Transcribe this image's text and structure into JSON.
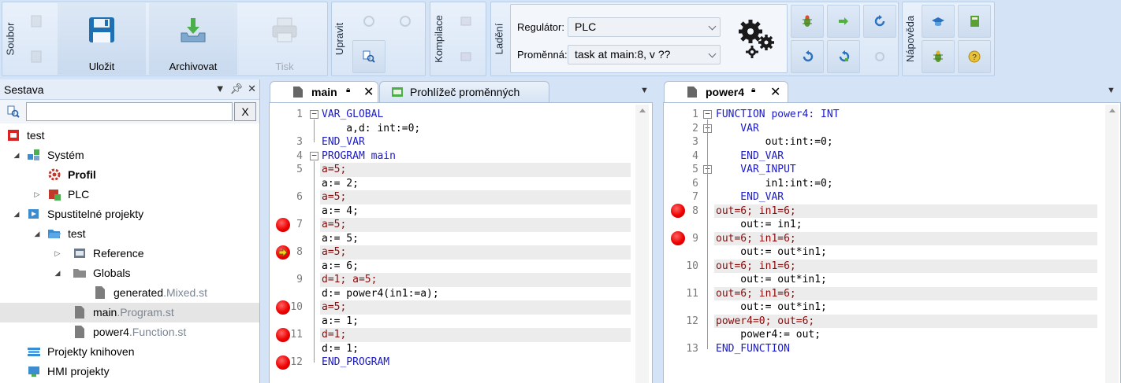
{
  "ribbon": {
    "groups": {
      "soubor": "Soubor",
      "upravit": "Upravit",
      "kompilace": "Kompilace",
      "ladeni": "Ladění",
      "napoveda": "Nápověda"
    },
    "save_label": "Uložit",
    "archive_label": "Archivovat",
    "print_label": "Tisk",
    "regulator_label": "Regulátor:",
    "regulator_value": "PLC",
    "variable_label": "Proměnná:",
    "variable_value": "task at main:8, v ??"
  },
  "left_panel": {
    "title": "Sestava",
    "clear_button": "X",
    "search_value": "",
    "tree": [
      {
        "label": "test",
        "ext": "",
        "icon": "project-red-icon"
      },
      {
        "label": "Systém",
        "ext": "",
        "icon": "system-icon"
      },
      {
        "label": "Profil",
        "ext": "",
        "icon": "gear-red-icon"
      },
      {
        "label": "PLC",
        "ext": "",
        "icon": "plc-icon"
      },
      {
        "label": "Spustitelné projekty",
        "ext": "",
        "icon": "executable-projects-icon"
      },
      {
        "label": "test",
        "ext": "",
        "icon": "folder-open-icon"
      },
      {
        "label": "Reference",
        "ext": "",
        "icon": "reference-icon"
      },
      {
        "label": "Globals",
        "ext": "",
        "icon": "folder-icon"
      },
      {
        "label": "generated",
        "ext": ".Mixed.st",
        "icon": "file-icon"
      },
      {
        "label": "main",
        "ext": ".Program.st",
        "icon": "file-icon"
      },
      {
        "label": "power4",
        "ext": ".Function.st",
        "icon": "file-icon"
      },
      {
        "label": "Projekty knihoven",
        "ext": "",
        "icon": "library-icon"
      },
      {
        "label": "HMI projekty",
        "ext": "",
        "icon": "hmi-icon"
      }
    ]
  },
  "editor_left": {
    "tabs": [
      {
        "label": "main"
      },
      {
        "label": "Prohlížeč proměnných"
      }
    ],
    "lines": [
      {
        "num": "1",
        "code": "VAR_GLOBAL",
        "kind": "kw"
      },
      {
        "num": "",
        "code": "    a,d: int:=0;",
        "kind": "decl"
      },
      {
        "num": "3",
        "code": "END_VAR",
        "kind": "kw"
      },
      {
        "num": "4",
        "code": "PROGRAM main",
        "kind": "prog"
      },
      {
        "num": "5",
        "code": "a=5;",
        "kind": "cur"
      },
      {
        "num": "",
        "code": "a:= 2;",
        "kind": "plain"
      },
      {
        "num": "6",
        "code": "a=5;",
        "kind": "cur"
      },
      {
        "num": "",
        "code": "a:= 4;",
        "kind": "plain"
      },
      {
        "num": "7",
        "code": "a=5;",
        "kind": "cur"
      },
      {
        "num": "",
        "code": "a:= 5;",
        "kind": "plain"
      },
      {
        "num": "8",
        "code": "a=5;",
        "kind": "cur"
      },
      {
        "num": "",
        "code": "a:= 6;",
        "kind": "plain"
      },
      {
        "num": "9",
        "code": "d=1; a=5;",
        "kind": "cur"
      },
      {
        "num": "",
        "code": "d:= power4(in1:=a);",
        "kind": "plain"
      },
      {
        "num": "10",
        "code": "a=5;",
        "kind": "cur"
      },
      {
        "num": "",
        "code": "a:= 1;",
        "kind": "plain"
      },
      {
        "num": "11",
        "code": "d=1;",
        "kind": "cur"
      },
      {
        "num": "",
        "code": "d:= 1;",
        "kind": "plain"
      },
      {
        "num": "12",
        "code": "END_PROGRAM",
        "kind": "kw"
      }
    ]
  },
  "editor_right": {
    "tabs": [
      {
        "label": "power4"
      }
    ],
    "lines": [
      {
        "num": "1",
        "code": "FUNCTION power4: INT",
        "kind": "func"
      },
      {
        "num": "2",
        "code": "    VAR",
        "kind": "kw"
      },
      {
        "num": "3",
        "code": "        out:int:=0;",
        "kind": "decl"
      },
      {
        "num": "4",
        "code": "    END_VAR",
        "kind": "kw"
      },
      {
        "num": "5",
        "code": "    VAR_INPUT",
        "kind": "kw"
      },
      {
        "num": "6",
        "code": "        in1:int:=0;",
        "kind": "decl"
      },
      {
        "num": "7",
        "code": "    END_VAR",
        "kind": "kw"
      },
      {
        "num": "8",
        "code": "out=6; in1=6;",
        "kind": "cur"
      },
      {
        "num": "",
        "code": "    out:= in1;",
        "kind": "plain"
      },
      {
        "num": "9",
        "code": "out=6; in1=6;",
        "kind": "cur"
      },
      {
        "num": "",
        "code": "    out:= out*in1;",
        "kind": "plain"
      },
      {
        "num": "10",
        "code": "out=6; in1=6;",
        "kind": "cur"
      },
      {
        "num": "",
        "code": "    out:= out*in1;",
        "kind": "plain"
      },
      {
        "num": "11",
        "code": "out=6; in1=6;",
        "kind": "cur"
      },
      {
        "num": "",
        "code": "    out:= out*in1;",
        "kind": "plain"
      },
      {
        "num": "12",
        "code": "power4=0; out=6;",
        "kind": "cur"
      },
      {
        "num": "",
        "code": "    power4:= out;",
        "kind": "plain"
      },
      {
        "num": "13",
        "code": "END_FUNCTION",
        "kind": "kw"
      }
    ]
  },
  "colors": {
    "keyword": "#1a1ac9",
    "current_value": "#8a0a0a",
    "breakpoint": "#e00000",
    "ribbon_bg": "#d4e3f5"
  }
}
